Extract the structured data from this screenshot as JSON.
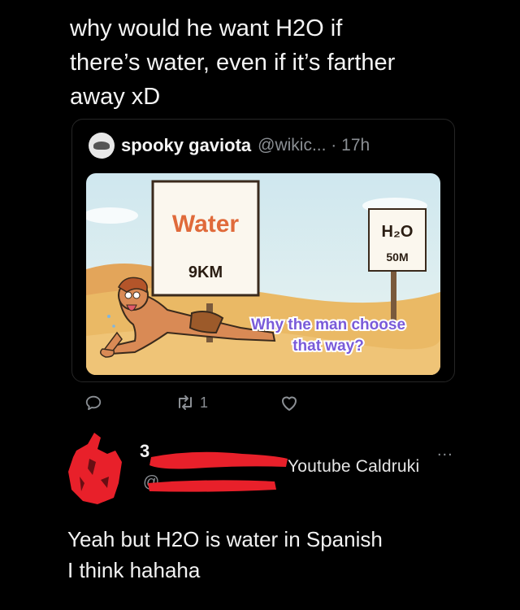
{
  "post": {
    "text_line1": "why would he want H2O if",
    "text_line2": "there’s water, even if it’s farther",
    "text_line3": "away xD"
  },
  "quoted": {
    "author_name": "spooky gaviota",
    "handle_time": "@wikic... · 17h",
    "image": {
      "sign_left_title": "Water",
      "sign_left_distance": "9KM",
      "sign_right_title": "H₂O",
      "sign_right_distance": "50M",
      "caption_line1": "Why the man choose",
      "caption_line2": "that way?"
    }
  },
  "actions": {
    "reply_icon": "reply-icon",
    "retweet_icon": "retweet-icon",
    "retweet_count": "1",
    "like_icon": "like-icon"
  },
  "reply": {
    "name_fragment": "3",
    "handle_fragment": "@",
    "more": "...",
    "watermark": "Youtube Caldruki",
    "text_line1": "Yeah but H2O is water in Spanish",
    "text_line2": "I think hahaha"
  },
  "colors": {
    "background": "#000000",
    "redaction": "#e8202a",
    "sign": "#fbf7ee",
    "sand": "#e9b55f",
    "caption_fill": "#7a5bd9"
  }
}
